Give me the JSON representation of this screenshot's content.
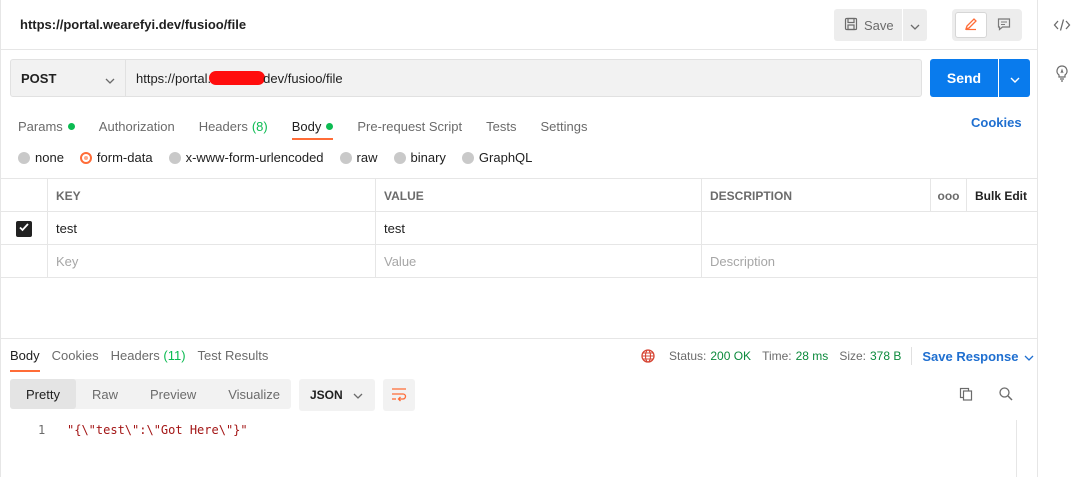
{
  "request": {
    "title": "https://portal.wearefyi.dev/fusioo/file",
    "method": "POST",
    "url_prefix": "https://portal.",
    "url_suffix": "dev/fusioo/file",
    "save_label": "Save",
    "send_label": "Send"
  },
  "tabs": {
    "params": "Params",
    "authorization": "Authorization",
    "headers": "Headers",
    "headers_count": "(8)",
    "body": "Body",
    "prerequest": "Pre-request Script",
    "tests": "Tests",
    "settings": "Settings",
    "cookies": "Cookies"
  },
  "body_types": {
    "none": "none",
    "form_data": "form-data",
    "urlencoded": "x-www-form-urlencoded",
    "raw": "raw",
    "binary": "binary",
    "graphql": "GraphQL"
  },
  "table": {
    "key_header": "KEY",
    "value_header": "VALUE",
    "description_header": "DESCRIPTION",
    "more": "ooo",
    "bulk_edit": "Bulk Edit",
    "rows": [
      {
        "key": "test",
        "value": "test",
        "description": ""
      }
    ],
    "key_placeholder": "Key",
    "value_placeholder": "Value",
    "description_placeholder": "Description"
  },
  "response": {
    "tabs": {
      "body": "Body",
      "cookies": "Cookies",
      "headers": "Headers",
      "headers_count": "(11)",
      "test_results": "Test Results"
    },
    "status_label": "Status:",
    "status_value": "200 OK",
    "time_label": "Time:",
    "time_value": "28 ms",
    "size_label": "Size:",
    "size_value": "378 B",
    "save_response": "Save Response",
    "views": {
      "pretty": "Pretty",
      "raw": "Raw",
      "preview": "Preview",
      "visualize": "Visualize"
    },
    "format": "JSON",
    "line_number": "1",
    "body_text": "\"{\\\"test\\\":\\\"Got Here\\\"}\""
  },
  "colors": {
    "accent": "#ff6c37",
    "primary": "#097bed",
    "success": "#0cbb52",
    "link": "#1f6fd0"
  }
}
